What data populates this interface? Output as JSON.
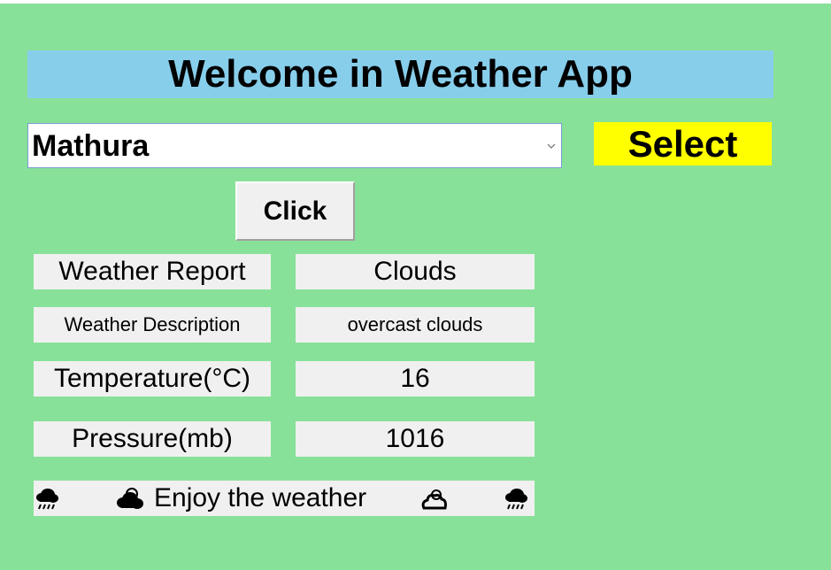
{
  "app": {
    "title": "Welcome in Weather App"
  },
  "city_select": {
    "selected": "Mathura",
    "label": "Select"
  },
  "action": {
    "click_label": "Click"
  },
  "report": {
    "rows": [
      {
        "label": "Weather Report",
        "value": "Clouds"
      },
      {
        "label": "Weather Description",
        "value": "overcast clouds"
      },
      {
        "label": "Temperature(°C)",
        "value": "16"
      },
      {
        "label": "Pressure(mb)",
        "value": "1016"
      }
    ]
  },
  "footer": {
    "message": "Enjoy the weather",
    "icons": [
      "rain-cloud-icon",
      "cloud-icon",
      "cloud-outline-icon",
      "rain-cloud-icon"
    ]
  },
  "colors": {
    "background": "#88e199",
    "title_bg": "#87ceeb",
    "select_bg": "#ffff00",
    "cell_bg": "#f0f0f0"
  }
}
